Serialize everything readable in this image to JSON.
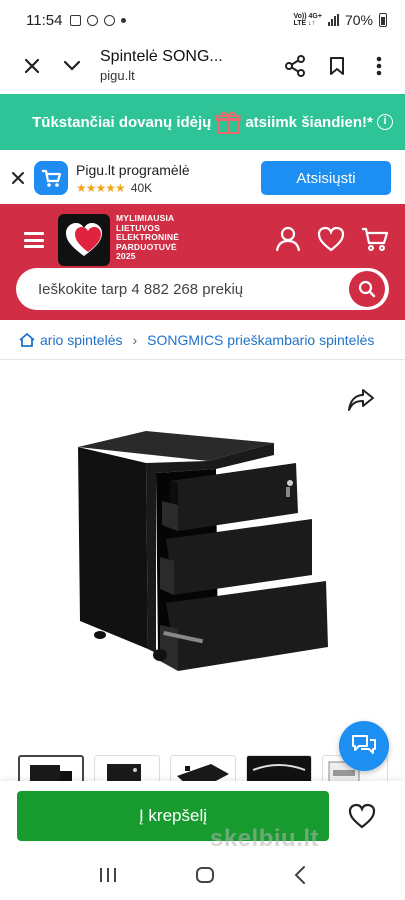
{
  "statusbar": {
    "time": "11:54",
    "battery": "70%",
    "net_top": "Vo)) 4G+",
    "net_bottom": "LTE ↓↑"
  },
  "browser": {
    "title": "Spintelė SONG...",
    "url": "pigu.lt"
  },
  "promo": {
    "text_before": "Tūkstančiai dovanų idėjų",
    "text_after": "atsiimk šiandien!*",
    "info": "i"
  },
  "app_banner": {
    "title": "Pigu.lt programėlė",
    "stars": "★★★★★",
    "rating_count": "40K",
    "button": "Atsisiųsti"
  },
  "header": {
    "logo_text": [
      "MYLIMIAUSIA",
      "LIETUVOS",
      "ELEKTRONINĖ",
      "PARDUOTUVĖ",
      "2025"
    ],
    "search_placeholder": "Ieškokite tarp 4 882 268 prekių"
  },
  "breadcrumb": {
    "items": [
      "ario spintelės",
      "SONGMICS prieškambario spintelės"
    ]
  },
  "actions": {
    "cart_button": "Į krepšelį",
    "watermark": "skelbiu.lt"
  },
  "colors": {
    "brand_red": "#d12e46",
    "promo_green": "#2ec497",
    "cart_green": "#189b2e",
    "accent_blue": "#1d8ef2"
  }
}
